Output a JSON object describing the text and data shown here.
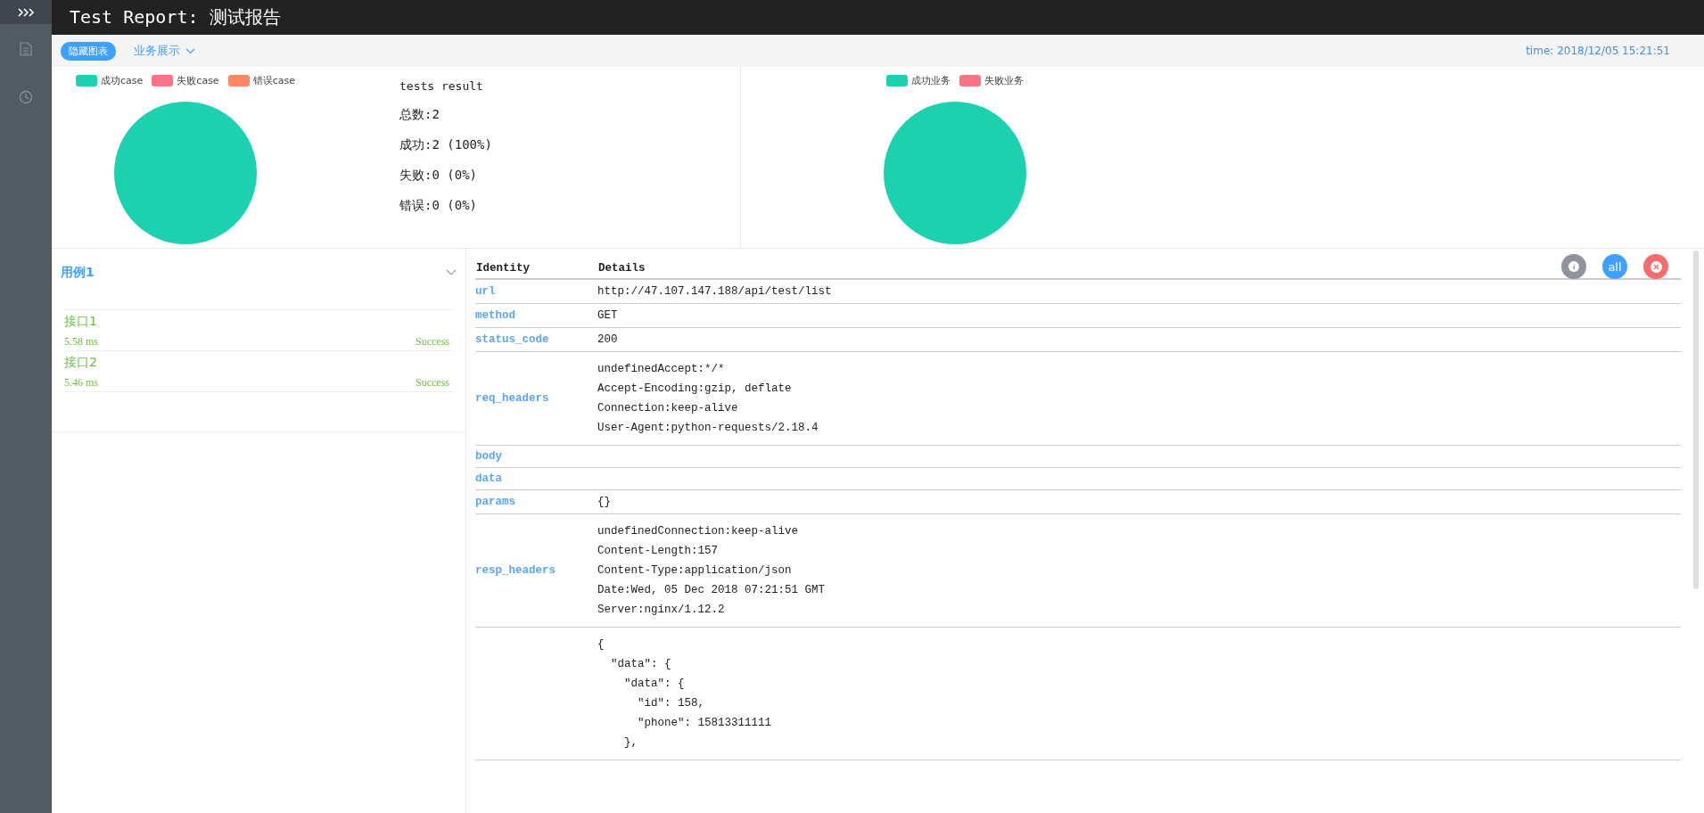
{
  "header": {
    "title": "Test Report: 测试报告"
  },
  "toolbar": {
    "hide_charts_button": "隐藏图表",
    "business_menu": "业务展示",
    "time": "time: 2018/12/05 15:21:51"
  },
  "case_chart": {
    "legend": [
      {
        "label": "成功case",
        "color": "#1bd1b0"
      },
      {
        "label": "失败case",
        "color": "#f97385"
      },
      {
        "label": "错误case",
        "color": "#fe8862"
      }
    ]
  },
  "summary": {
    "title": "tests result",
    "lines": [
      "总数:2",
      "成功:2 (100%)",
      "失败:0 (0%)",
      "错误:0 (0%)"
    ]
  },
  "business_chart": {
    "legend": [
      {
        "label": "成功业务",
        "color": "#1bd1b0"
      },
      {
        "label": "失败业务",
        "color": "#f97385"
      }
    ]
  },
  "cases": [
    {
      "name": "用例1",
      "expanded": true,
      "interfaces": [
        {
          "name": "接口1",
          "duration": "5.58 ms",
          "status": "Success",
          "selected": false
        },
        {
          "name": "接口2",
          "duration": "5.46 ms",
          "status": "Success",
          "selected": false
        }
      ]
    }
  ],
  "detail_buttons": [
    {
      "kind": "info"
    },
    {
      "kind": "all",
      "label": "all"
    },
    {
      "kind": "close"
    }
  ],
  "table": {
    "columns": [
      "Identity",
      "Details"
    ],
    "rows": [
      {
        "key": "url",
        "lines": [
          "http://47.107.147.188/api/test/list"
        ]
      },
      {
        "key": "method",
        "lines": [
          "GET"
        ]
      },
      {
        "key": "status_code",
        "lines": [
          "200"
        ]
      },
      {
        "key": "req_headers",
        "lines": [
          "undefinedAccept:*/*",
          "Accept-Encoding:gzip, deflate",
          "Connection:keep-alive",
          "User-Agent:python-requests/2.18.4"
        ]
      },
      {
        "key": "body"
      },
      {
        "key": "data"
      },
      {
        "key": "params",
        "lines": [
          "{}"
        ]
      },
      {
        "key": "resp_headers",
        "lines": [
          "undefinedConnection:keep-alive",
          "Content-Length:157",
          "Content-Type:application/json",
          "Date:Wed, 05 Dec 2018 07:21:51 GMT",
          "Server:nginx/1.12.2"
        ]
      },
      {
        "lines": [
          "{",
          "  \"data\": {",
          "    \"data\": {",
          "      \"id\": 158,",
          "      \"phone\": 15813311111",
          "    },"
        ]
      }
    ]
  }
}
